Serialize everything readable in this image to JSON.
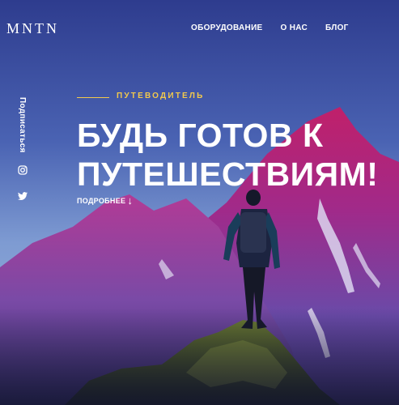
{
  "logo": "MNTN",
  "nav": {
    "items": [
      "ОБОРУДОВАНИЕ",
      "О НАС",
      "БЛОГ"
    ]
  },
  "side": {
    "subscribe": "Подписаться",
    "icons": [
      "instagram-icon",
      "twitter-icon"
    ]
  },
  "hero": {
    "eyebrow": "ПУТЕВОДИТЕЛЬ",
    "headline": "БУДЬ ГОТОВ К ПУТЕШЕСТВИЯМ!",
    "more": "ПОДРОБНЕЕ",
    "accent": "#f2c94c"
  }
}
